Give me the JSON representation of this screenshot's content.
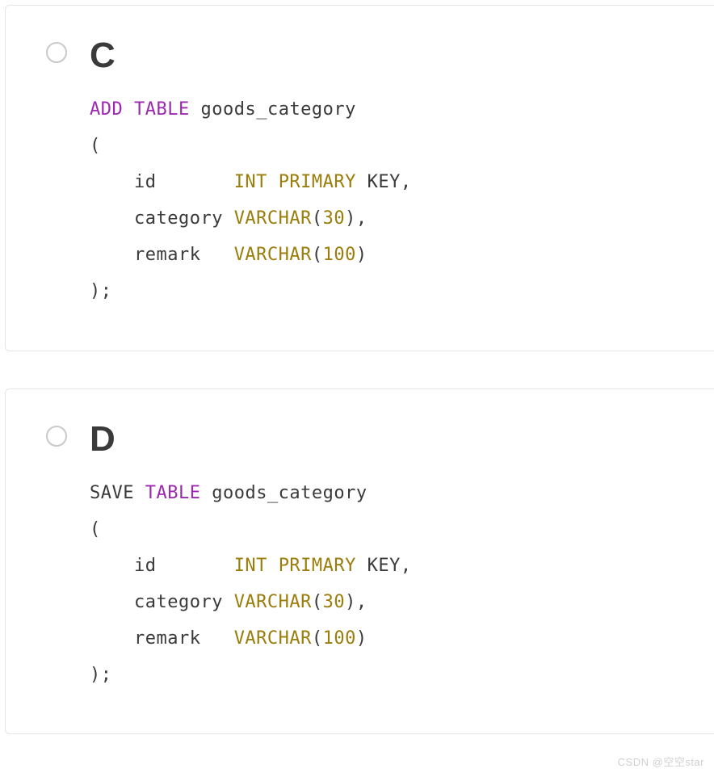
{
  "options": [
    {
      "letter": "C",
      "code": {
        "line1": {
          "kw1": "ADD",
          "kw2": "TABLE",
          "rest": " goods_category"
        },
        "line2": "(",
        "line3": {
          "indent": "    id       ",
          "kw1": "INT",
          "kw2": "PRIMARY",
          "rest": " KEY,"
        },
        "line4": {
          "indent": "    category ",
          "kw": "VARCHAR",
          "paren_open": "(",
          "num": "30",
          "paren_close": "),",
          "rest": ""
        },
        "line5": {
          "indent": "    remark   ",
          "kw": "VARCHAR",
          "paren_open": "(",
          "num": "100",
          "paren_close": ")",
          "rest": ""
        },
        "line6": ");"
      }
    },
    {
      "letter": "D",
      "code": {
        "line1": {
          "kw1": "SAVE ",
          "kw2": "TABLE",
          "rest": " goods_category"
        },
        "line2": "(",
        "line3": {
          "indent": "    id       ",
          "kw1": "INT",
          "kw2": "PRIMARY",
          "rest": " KEY,"
        },
        "line4": {
          "indent": "    category ",
          "kw": "VARCHAR",
          "paren_open": "(",
          "num": "30",
          "paren_close": "),",
          "rest": ""
        },
        "line5": {
          "indent": "    remark   ",
          "kw": "VARCHAR",
          "paren_open": "(",
          "num": "100",
          "paren_close": ")",
          "rest": ""
        },
        "line6": ");"
      }
    }
  ],
  "watermark": "CSDN @空空star",
  "first_kw_plain_for_D_note": "SAVE in option D first word is not purple"
}
